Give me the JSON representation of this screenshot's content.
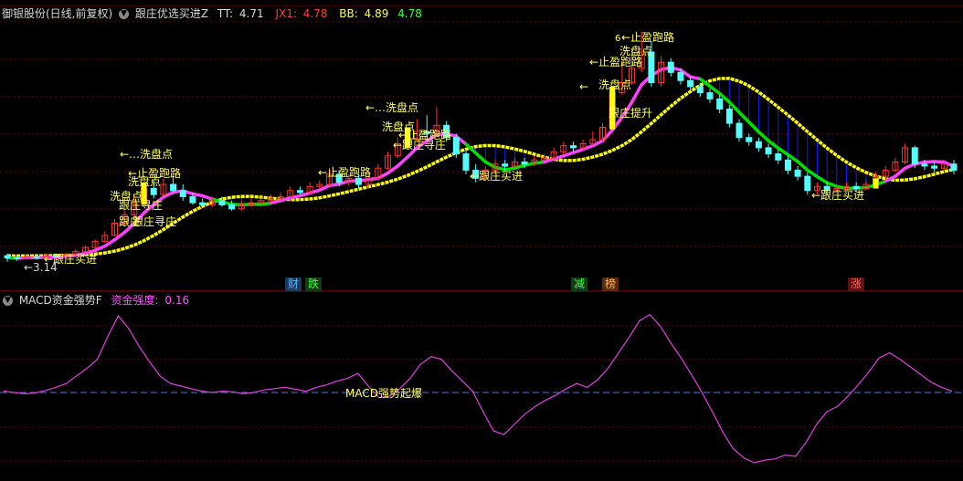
{
  "header": {
    "stock_title": "御银股份(日线,前复权)",
    "indicator_name": "跟庄优选买进Z",
    "tt_label": "TT:",
    "tt_value": "4.71",
    "jx1_label": "JX1:",
    "jx1_value": "4.78",
    "bb_label": "BB:",
    "bb_value": "4.89",
    "bb2_value": "4.78",
    "menu_icon": "chevron-down-icon"
  },
  "colors": {
    "background": "#000000",
    "rise": "#ff3232",
    "fall": "#54fcfc",
    "line_magenta": "#ff40ff",
    "line_yellow": "#ffff00",
    "line_green": "#00e000",
    "fill_blue": "#1818ff",
    "grid": "#700000",
    "label": "#ffff60"
  },
  "main_labels": {
    "low_price": "←3.14",
    "buy": "←跟庄买进",
    "wash": "←…洗盘点",
    "wash_short": "洗盘点",
    "wash_arrow": "←",
    "profit": "止盈跑路",
    "profit_arrow": "←止盈跑路",
    "profit_top": "←止盈跑路",
    "find": "←跟庄寻庄",
    "find_short": "跟庄寻庄",
    "boost": "跟庄",
    "boost2": "跟庄提升",
    "boost3": "跟庄寻庄",
    "enter": "跟庄",
    "wash_top": "洗盘点",
    "wash_top2": "洗盘点",
    "a_count": "6"
  },
  "badges": [
    {
      "text": "财",
      "color": "#5ab4ff",
      "bg": "#1e3a5a"
    },
    {
      "text": "跌",
      "color": "#3cff3c",
      "bg": "#143c14"
    },
    {
      "text": "减",
      "color": "#3cff3c",
      "bg": "#143c14"
    },
    {
      "text": "榜",
      "color": "#ffb464",
      "bg": "#5a2a0a"
    },
    {
      "text": "涨",
      "color": "#ff6464",
      "bg": "#5a1414"
    }
  ],
  "sub": {
    "title": "MACD资金强势F",
    "strength_label": "资金强度:",
    "strength_value": "0.16",
    "signal_label": "MACD强势起爆"
  },
  "chart_data": {
    "type": "candlestick",
    "candles": [
      [
        3.2,
        3.18,
        3.22,
        3.14
      ],
      [
        3.18,
        3.17,
        3.2,
        3.15
      ],
      [
        3.17,
        3.19,
        3.21,
        3.16
      ],
      [
        3.19,
        3.18,
        3.21,
        3.16
      ],
      [
        3.18,
        3.2,
        3.22,
        3.17
      ],
      [
        3.2,
        3.19,
        3.22,
        3.17
      ],
      [
        3.19,
        3.21,
        3.23,
        3.18
      ],
      [
        3.21,
        3.24,
        3.26,
        3.2
      ],
      [
        3.24,
        3.28,
        3.3,
        3.23
      ],
      [
        3.28,
        3.34,
        3.36,
        3.27
      ],
      [
        3.34,
        3.4,
        3.44,
        3.33
      ],
      [
        3.4,
        3.52,
        3.56,
        3.39
      ],
      [
        3.52,
        3.6,
        3.64,
        3.5
      ],
      [
        3.6,
        3.72,
        3.8,
        3.58
      ],
      [
        3.72,
        3.86,
        3.92,
        3.7
      ],
      [
        3.86,
        3.8,
        3.94,
        3.76
      ],
      [
        3.8,
        3.9,
        3.96,
        3.78
      ],
      [
        3.9,
        3.84,
        3.98,
        3.8
      ],
      [
        3.84,
        3.78,
        3.9,
        3.74
      ],
      [
        3.78,
        3.72,
        3.82,
        3.7
      ],
      [
        3.72,
        3.7,
        3.76,
        3.68
      ],
      [
        3.7,
        3.74,
        3.78,
        3.68
      ],
      [
        3.74,
        3.7,
        3.78,
        3.68
      ],
      [
        3.7,
        3.66,
        3.74,
        3.64
      ],
      [
        3.66,
        3.7,
        3.74,
        3.64
      ],
      [
        3.7,
        3.72,
        3.76,
        3.68
      ],
      [
        3.72,
        3.74,
        3.78,
        3.7
      ],
      [
        3.74,
        3.76,
        3.8,
        3.72
      ],
      [
        3.76,
        3.78,
        3.82,
        3.74
      ],
      [
        3.78,
        3.84,
        3.88,
        3.76
      ],
      [
        3.84,
        3.82,
        3.88,
        3.8
      ],
      [
        3.82,
        3.88,
        3.92,
        3.8
      ],
      [
        3.88,
        3.9,
        3.94,
        3.86
      ],
      [
        3.9,
        4.0,
        4.06,
        3.88
      ],
      [
        4.0,
        3.92,
        4.04,
        3.88
      ],
      [
        3.92,
        3.96,
        4.0,
        3.88
      ],
      [
        3.96,
        3.9,
        4.0,
        3.86
      ],
      [
        3.9,
        3.96,
        4.0,
        3.86
      ],
      [
        3.96,
        4.06,
        4.1,
        3.94
      ],
      [
        4.06,
        4.18,
        4.22,
        4.04
      ],
      [
        4.18,
        4.3,
        4.36,
        4.16
      ],
      [
        4.3,
        4.34,
        4.46,
        4.26
      ],
      [
        4.34,
        4.42,
        4.54,
        4.32
      ],
      [
        4.42,
        4.4,
        4.58,
        4.36
      ],
      [
        4.4,
        4.48,
        4.66,
        4.38
      ],
      [
        4.48,
        4.36,
        4.52,
        4.32
      ],
      [
        4.36,
        4.2,
        4.4,
        4.16
      ],
      [
        4.2,
        4.04,
        4.24,
        4.0
      ],
      [
        4.04,
        3.96,
        4.1,
        3.92
      ],
      [
        3.96,
        4.04,
        4.08,
        3.94
      ],
      [
        4.04,
        4.1,
        4.14,
        4.0
      ],
      [
        4.1,
        4.08,
        4.14,
        4.04
      ],
      [
        4.08,
        4.12,
        4.16,
        4.06
      ],
      [
        4.12,
        4.1,
        4.16,
        4.06
      ],
      [
        4.1,
        4.14,
        4.18,
        4.08
      ],
      [
        4.14,
        4.16,
        4.2,
        4.12
      ],
      [
        4.16,
        4.22,
        4.26,
        4.14
      ],
      [
        4.22,
        4.28,
        4.32,
        4.2
      ],
      [
        4.28,
        4.26,
        4.32,
        4.22
      ],
      [
        4.26,
        4.3,
        4.34,
        4.24
      ],
      [
        4.3,
        4.34,
        4.42,
        4.28
      ],
      [
        4.34,
        4.46,
        4.5,
        4.32
      ],
      [
        4.46,
        4.8,
        4.86,
        4.44
      ],
      [
        4.8,
        4.9,
        5.1,
        4.78
      ],
      [
        4.9,
        5.04,
        5.24,
        4.88
      ],
      [
        5.04,
        5.2,
        5.4,
        5.0
      ],
      [
        5.2,
        4.9,
        5.3,
        4.86
      ],
      [
        4.9,
        5.1,
        5.16,
        4.86
      ],
      [
        5.1,
        5.0,
        5.14,
        4.96
      ],
      [
        5.0,
        4.92,
        5.04,
        4.88
      ],
      [
        4.92,
        4.86,
        4.96,
        4.82
      ],
      [
        4.86,
        4.8,
        4.9,
        4.76
      ],
      [
        4.8,
        4.74,
        4.84,
        4.7
      ],
      [
        4.74,
        4.64,
        4.78,
        4.6
      ],
      [
        4.64,
        4.5,
        4.68,
        4.46
      ],
      [
        4.5,
        4.36,
        4.54,
        4.32
      ],
      [
        4.36,
        4.32,
        4.4,
        4.28
      ],
      [
        4.32,
        4.26,
        4.36,
        4.22
      ],
      [
        4.26,
        4.2,
        4.3,
        4.16
      ],
      [
        4.2,
        4.14,
        4.24,
        4.1
      ],
      [
        4.14,
        4.04,
        4.18,
        4.0
      ],
      [
        4.04,
        3.98,
        4.08,
        3.94
      ],
      [
        3.98,
        3.84,
        4.02,
        3.8
      ],
      [
        3.84,
        3.88,
        3.92,
        3.8
      ],
      [
        3.88,
        3.84,
        3.92,
        3.8
      ],
      [
        3.84,
        3.86,
        3.9,
        3.82
      ],
      [
        3.86,
        3.88,
        3.92,
        3.84
      ],
      [
        3.88,
        3.86,
        3.92,
        3.82
      ],
      [
        3.86,
        3.9,
        3.94,
        3.84
      ],
      [
        3.9,
        3.98,
        4.02,
        3.88
      ],
      [
        3.98,
        4.04,
        4.08,
        3.96
      ],
      [
        4.04,
        4.12,
        4.16,
        4.02
      ],
      [
        4.12,
        4.26,
        4.3,
        4.1
      ],
      [
        4.26,
        4.1,
        4.28,
        4.06
      ],
      [
        4.1,
        4.08,
        4.14,
        4.04
      ],
      [
        4.08,
        4.06,
        4.12,
        4.02
      ],
      [
        4.06,
        4.1,
        4.14,
        4.04
      ],
      [
        4.1,
        4.04,
        4.14,
        4.0
      ]
    ],
    "macd_strength": [
      0.02,
      0.0,
      -0.02,
      -0.01,
      0.03,
      0.08,
      0.14,
      0.26,
      0.38,
      0.52,
      0.88,
      1.2,
      1.0,
      0.72,
      0.48,
      0.26,
      0.14,
      0.1,
      0.06,
      0.02,
      0.0,
      0.02,
      0.01,
      -0.02,
      0.0,
      0.04,
      0.06,
      0.08,
      0.05,
      0.02,
      0.08,
      0.12,
      0.18,
      0.22,
      0.3,
      0.1,
      -0.08,
      -0.06,
      0.06,
      0.22,
      0.44,
      0.56,
      0.52,
      0.34,
      0.18,
      0.02,
      -0.3,
      -0.6,
      -0.66,
      -0.5,
      -0.34,
      -0.22,
      -0.12,
      -0.04,
      0.06,
      0.14,
      0.08,
      0.2,
      0.38,
      0.62,
      0.86,
      1.12,
      1.22,
      1.04,
      0.78,
      0.54,
      0.28,
      0.0,
      -0.3,
      -0.62,
      -0.88,
      -1.02,
      -1.1,
      -1.06,
      -1.04,
      -0.98,
      -1.0,
      -0.78,
      -0.5,
      -0.3,
      -0.22,
      -0.06,
      0.12,
      0.32,
      0.54,
      0.62,
      0.52,
      0.4,
      0.28,
      0.16,
      0.08,
      0.02
    ]
  }
}
